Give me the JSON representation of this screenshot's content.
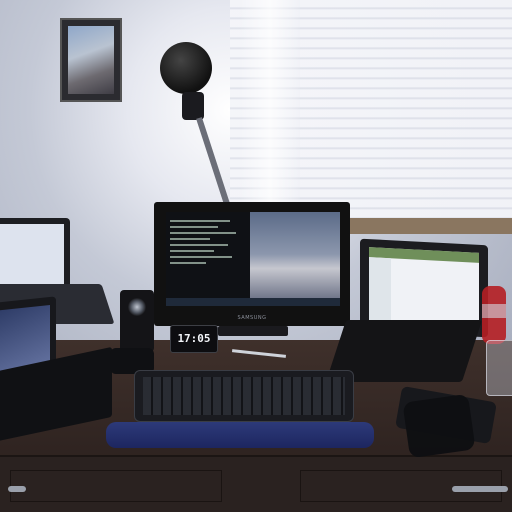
{
  "scene": {
    "clock_display": "17:05",
    "monitor_brand": "SAMSUNG"
  },
  "colors": {
    "wall": "#cfd3dd",
    "desk": "#3b2f2b",
    "wrist_rest": "#2d3a7a",
    "bottle": "#b51f24"
  }
}
